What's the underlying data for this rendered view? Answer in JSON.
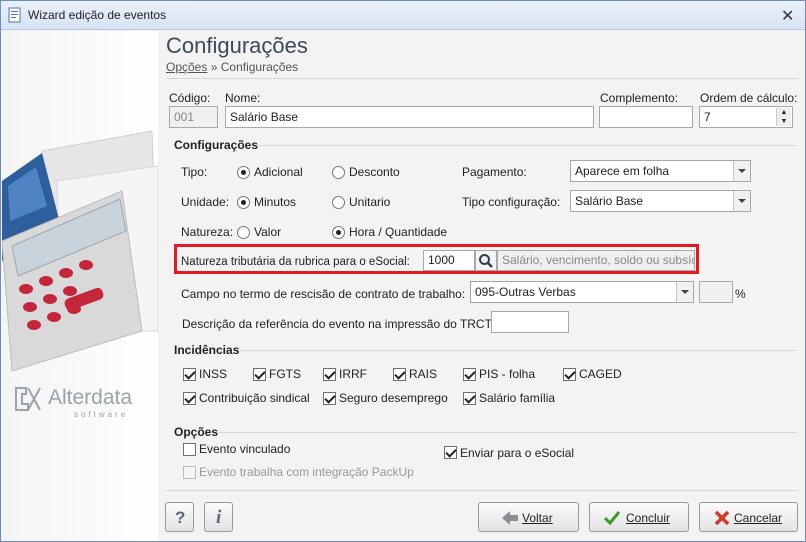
{
  "window": {
    "title": "Wizard edição de eventos"
  },
  "header": {
    "title": "Configurações",
    "breadcrumb_link": "Opções",
    "breadcrumb_sep": "»",
    "breadcrumb_current": "Configurações"
  },
  "sidebar": {
    "brand": "Alterdata",
    "brand_sub": "software"
  },
  "fields": {
    "codigo_label": "Código:",
    "codigo_value": "001",
    "nome_label": "Nome:",
    "nome_value": "Salário Base",
    "complemento_label": "Complemento:",
    "complemento_value": "",
    "ordem_label": "Ordem de cálculo:",
    "ordem_value": "7"
  },
  "config": {
    "section_title": "Configurações",
    "tipo_label": "Tipo:",
    "tipo_options": [
      "Adicional",
      "Desconto"
    ],
    "tipo_selected": "Adicional",
    "unidade_label": "Unidade:",
    "unidade_options": [
      "Minutos",
      "Unitario"
    ],
    "unidade_selected": "Minutos",
    "natureza_label": "Natureza:",
    "natureza_options": [
      "Valor",
      "Hora / Quantidade"
    ],
    "natureza_selected": "Hora / Quantidade",
    "pagamento_label": "Pagamento:",
    "pagamento_value": "Aparece em folha",
    "tipo_config_label": "Tipo configuração:",
    "tipo_config_value": "Salário Base",
    "natureza_trib_label": "Natureza tributária da rubrica para o eSocial:",
    "natureza_trib_code": "1000",
    "natureza_trib_desc": "Salário, vencimento, soldo ou subsídi",
    "campo_rescisao_label": "Campo no termo de rescisão de contrato de trabalho:",
    "campo_rescisao_value": "095-Outras Verbas",
    "percent_value": "",
    "percent_symbol": "%",
    "descricao_trct_label": "Descrição da referência do evento na impressão do TRCT:",
    "descricao_trct_value": ""
  },
  "incidencias": {
    "section_title": "Incidências",
    "items": [
      {
        "label": "INSS",
        "checked": true
      },
      {
        "label": "FGTS",
        "checked": true
      },
      {
        "label": "IRRF",
        "checked": true
      },
      {
        "label": "RAIS",
        "checked": true
      },
      {
        "label": "PIS - folha",
        "checked": true
      },
      {
        "label": "CAGED",
        "checked": true
      },
      {
        "label": "Contribuição sindical",
        "checked": true
      },
      {
        "label": "Seguro desemprego",
        "checked": true
      },
      {
        "label": "Salário família",
        "checked": true
      }
    ]
  },
  "opcoes": {
    "section_title": "Opções",
    "evento_vinculado": "Evento vinculado",
    "evento_packup": "Evento trabalha com integração PackUp",
    "enviar_esocial": "Enviar para o eSocial"
  },
  "footer": {
    "help_icon_label": "?",
    "info_icon_label": "i",
    "voltar": "Voltar",
    "concluir": "Concluir",
    "cancelar": "Cancelar"
  },
  "colors": {
    "highlight": "#e01b24",
    "accent_blue": "#2f5e9c",
    "concluir_green": "#3c9a2b",
    "cancel_red": "#d23a2a"
  }
}
